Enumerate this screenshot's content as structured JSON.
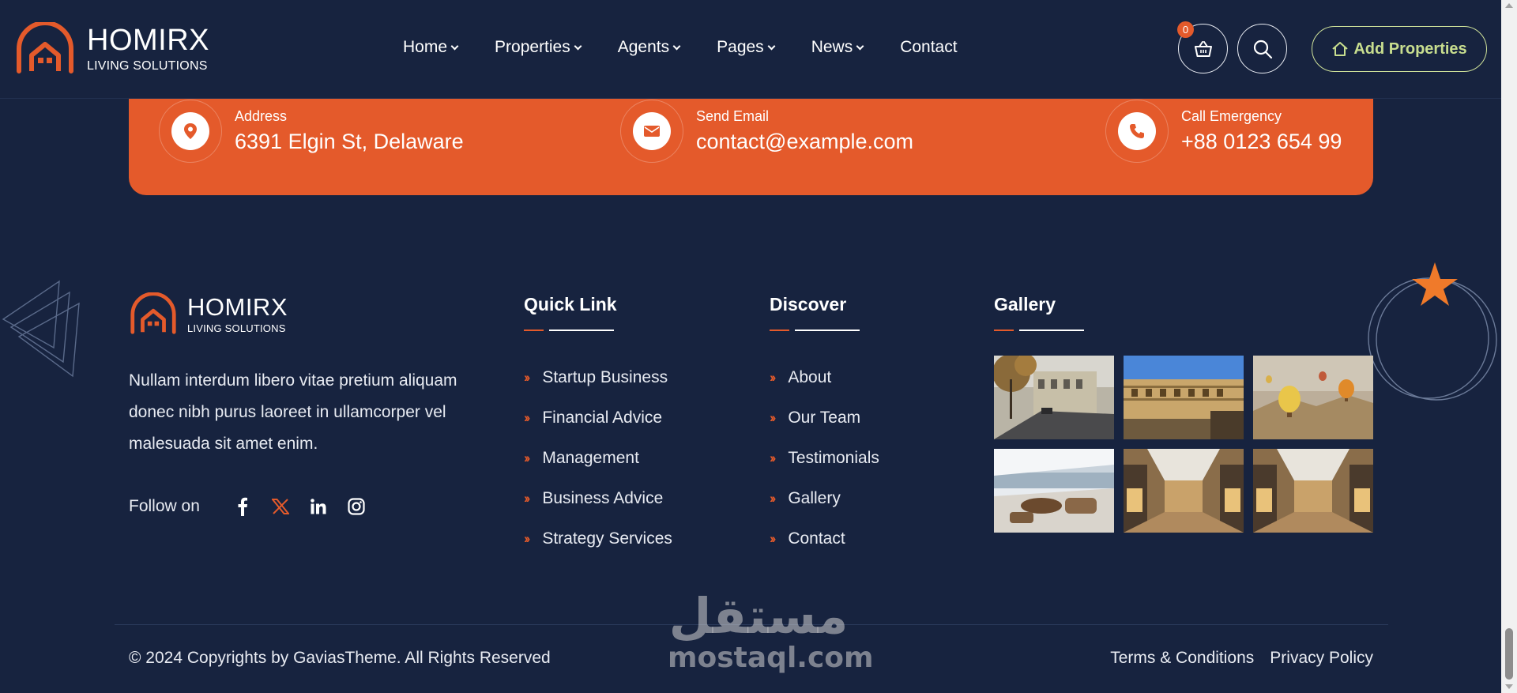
{
  "header": {
    "brand": {
      "name": "HOMIRX",
      "tagline": "LIVING SOLUTIONS"
    },
    "nav": [
      {
        "label": "Home",
        "has_dropdown": true
      },
      {
        "label": "Properties",
        "has_dropdown": true
      },
      {
        "label": "Agents",
        "has_dropdown": true
      },
      {
        "label": "Pages",
        "has_dropdown": true
      },
      {
        "label": "News",
        "has_dropdown": true
      },
      {
        "label": "Contact",
        "has_dropdown": false
      }
    ],
    "cart_count": "0",
    "add_button": "Add Properties"
  },
  "contact": {
    "address": {
      "label": "Address",
      "value": "6391 Elgin St, Delaware"
    },
    "email": {
      "label": "Send Email",
      "value": "contact@example.com"
    },
    "phone": {
      "label": "Call Emergency",
      "value": "+88 0123 654 99"
    }
  },
  "footer": {
    "brand": {
      "name": "HOMIRX",
      "tagline": "LIVING SOLUTIONS"
    },
    "description": "Nullam interdum libero vitae pretium aliquam donec nibh purus laoreet in ullamcorper vel malesuada sit amet enim.",
    "follow_label": "Follow on",
    "social": [
      "facebook-icon",
      "x-icon",
      "linkedin-icon",
      "instagram-icon"
    ],
    "quick_link": {
      "title": "Quick Link",
      "items": [
        "Startup Business",
        "Financial Advice",
        "Management",
        "Business Advice",
        "Strategy Services"
      ]
    },
    "discover": {
      "title": "Discover",
      "items": [
        "About",
        "Our Team",
        "Testimonials",
        "Gallery",
        "Contact"
      ]
    },
    "gallery": {
      "title": "Gallery",
      "images": [
        "city-street-autumn",
        "colosseum-rome",
        "hot-air-balloons",
        "yacht-deck-lounge",
        "shopping-mall-interior",
        "shopping-mall-interior"
      ]
    }
  },
  "bottom": {
    "copyright": "© 2024 Copyrights by GaviasTheme. All Rights Reserved",
    "links": [
      "Terms & Conditions",
      "Privacy Policy"
    ]
  },
  "watermark": {
    "arabic": "مستقل",
    "latin": "mostaql.com"
  },
  "colors": {
    "background": "#17233f",
    "accent": "#e45a2b",
    "add_button": "#c8de8f",
    "text": "#ffffff"
  }
}
